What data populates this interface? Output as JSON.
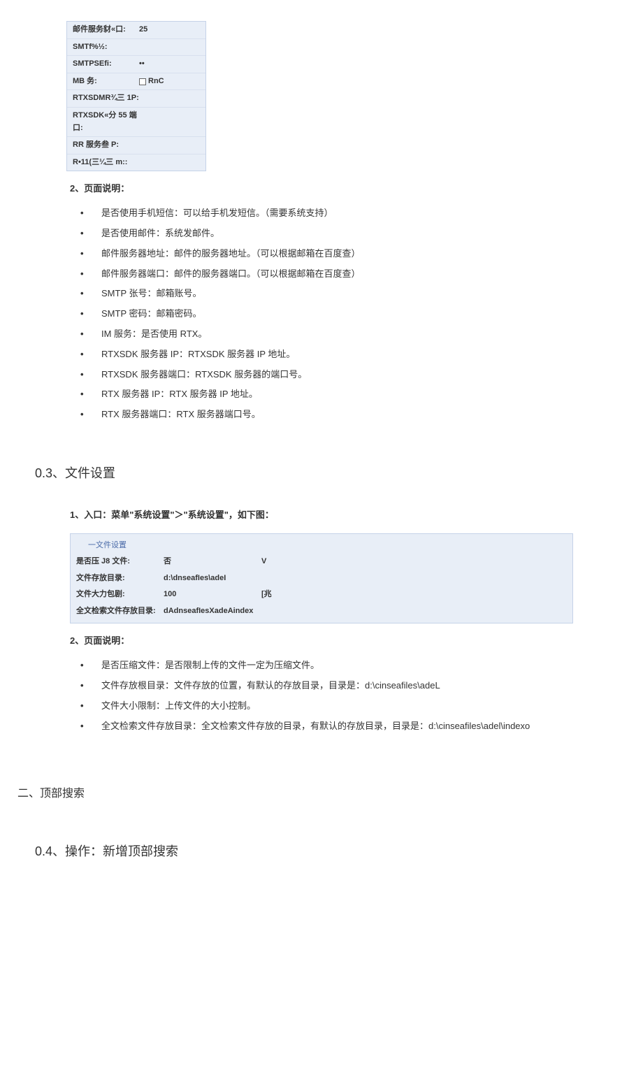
{
  "panel1": {
    "rows": [
      {
        "label": "邮件服务豺«口:",
        "value": "25"
      },
      {
        "label": "SMTf%½:",
        "value": ""
      },
      {
        "label": "SMTPSEfi:",
        "value": "••"
      },
      {
        "label": "MB 务:",
        "value": "RnC",
        "checkbox": true
      },
      {
        "label": "RTXSDMR¾三 1P:",
        "value": ""
      },
      {
        "label": "RTXSDK«分 55 端口:",
        "value": ""
      },
      {
        "label": "RR 服务叁 P:",
        "value": ""
      },
      {
        "label": "R•11(三¼三 m::",
        "value": ""
      }
    ]
  },
  "section1": {
    "header": "2、页面说明：",
    "bullets": [
      "是否使用手机短信：可以给手机发短信。（需要系统支持）",
      "是否使用邮件：系统发邮件。",
      "邮件服务器地址：邮件的服务器地址。（可以根据邮箱在百度查）",
      "邮件服务器端口：邮件的服务器端口。（可以根据邮箱在百度查）",
      "SMTP 张号：邮箱账号。",
      "SMTP 密码：邮箱密码。",
      "IM 服务：是否使用 RTX。",
      "RTXSDK 服务器 IP：RTXSDK 服务器 IP 地址。",
      "RTXSDK 服务器端口：RTXSDK 服务器的端口号。",
      "RTX 服务器 IP：RTX 服务器 IP 地址。",
      "RTX 服务器端口：RTX 服务器端口号。"
    ]
  },
  "heading03": "0.3、文件设置",
  "entry1": "1、入口：菜单\"系统设置\"＞\"系统设置\"，如下图：",
  "panel2": {
    "title": "一文件设置",
    "rows": [
      {
        "label": "是否压 J8 文件:",
        "value": "否",
        "unit": "V"
      },
      {
        "label": "文件存放目录:",
        "value": "d:\\dnseafIes\\adeI",
        "unit": ""
      },
      {
        "label": "文件大力包剧:",
        "value": "100",
        "unit": "[兆"
      },
      {
        "label": "全文检索文件存放目录:",
        "value": "dAdnseafIesXadeAindex",
        "unit": ""
      }
    ]
  },
  "section2": {
    "header": "2、页面说明：",
    "bullets": [
      "是否压缩文件：是否限制上传的文件一定为压缩文件。",
      "文件存放根目录：文件存放的位置，有默认的存放目录，目录是：d:\\cinseafiles\\adeL",
      "文件大小限制：上传文件的大小控制。",
      "全文检索文件存放目录：全文检索文件存放的目录，有默认的存放目录，目录是：d:\\cinseafiles\\adel\\indexo"
    ]
  },
  "heading2": "二、顶部搜索",
  "heading04": "0.4、操作：新增顶部搜索"
}
